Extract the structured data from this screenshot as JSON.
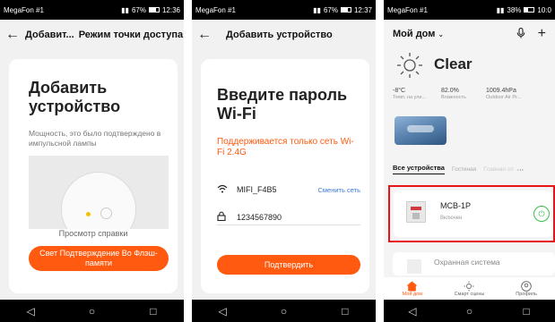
{
  "panel1": {
    "status": {
      "carrier": "MegaFon #1",
      "battery": "67%",
      "time": "12:36"
    },
    "header": {
      "back": "←",
      "title": "Добавит...",
      "mode": "Режим точки доступа"
    },
    "heading": "Добавить устройство",
    "description": "Мощность, это было подтверждено в импульсной лампы",
    "help_link": "Просмотр справки",
    "confirm_button": "Свет Подтверждение Во Флэш-памяти"
  },
  "panel2": {
    "status": {
      "carrier": "MegaFon #1",
      "battery": "67%",
      "time": "12:37"
    },
    "header": {
      "back": "←",
      "title": "Добавить устройство"
    },
    "heading": "Введите пароль Wi-Fi",
    "warning": "Поддерживается только сеть Wi-Fi 2.4G",
    "wifi_name": "MIFI_F4B5",
    "change_network": "Сменить сеть",
    "password": "1234567890",
    "confirm_button": "Подтвердить"
  },
  "panel3": {
    "status": {
      "carrier": "MegaFon #1",
      "battery": "38%",
      "time": "10:0"
    },
    "home_title": "Мой дом",
    "weather": {
      "condition": "Clear"
    },
    "stats": [
      {
        "value": "-8°C",
        "label": "Темп. на ули..."
      },
      {
        "value": "82.0%",
        "label": "Влажность"
      },
      {
        "value": "1009.4hPa",
        "label": "Outdoor Air Pr..."
      }
    ],
    "tabs": [
      "Все устройства",
      "Гостиная",
      "Главная сп"
    ],
    "devices": [
      {
        "name": "MCB-1P",
        "status": "Включен"
      },
      {
        "name": "Охранная система",
        "status": ""
      }
    ],
    "bottom_nav": [
      "Мой дом",
      "Смарт сцены",
      "Профиль"
    ],
    "accent": "#ff5a0f",
    "power_green": "#3bc14a",
    "highlight_red": "#e8141a"
  }
}
